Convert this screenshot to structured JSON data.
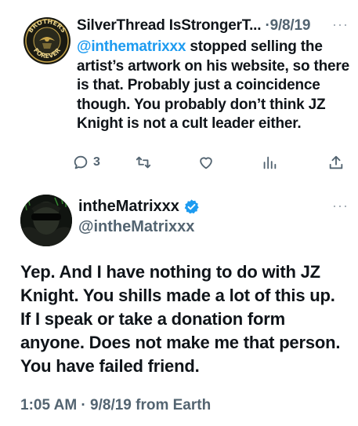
{
  "reply": {
    "author_name": "SilverThread IsStrongerT...",
    "separator": "·",
    "date": "9/8/19",
    "more_label": "···",
    "mention": "@inthematrixxx",
    "text_after_mention": " stopped selling the artist’s artwork on his website, so there is that. Probably just a coincidence though. You probably don’t think JZ Knight is not a cult leader either.",
    "avatar": {
      "icon": "brothers-forever-badge",
      "top_text": "BROTHERS",
      "bottom_text": "FOREVER"
    },
    "actions": {
      "reply_count": "3"
    }
  },
  "tweet": {
    "author_name": "intheMatrixxx",
    "handle": "@intheMatrixxx",
    "verified_icon": "verified-badge-icon",
    "more_label": "···",
    "text": "Yep. And I have nothing to do with JZ Knight. You shills made a lot of this up. If I speak or take a donation form anyone. Does not make me that person. You have failed friend.",
    "timestamp": "1:05 AM · 9/8/19 from Earth"
  },
  "colors": {
    "link": "#1d9bf0",
    "secondary_text": "#536471",
    "verified": "#1d9bf0"
  }
}
